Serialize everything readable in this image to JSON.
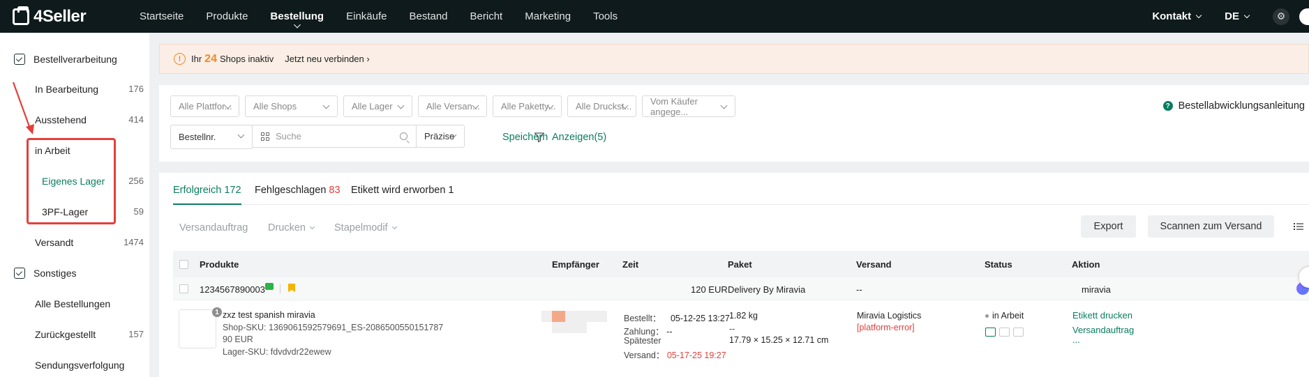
{
  "topbar": {
    "logo": "4Seller",
    "nav": [
      "Startseite",
      "Produkte",
      "Bestellung",
      "Einkäufe",
      "Bestand",
      "Bericht",
      "Marketing",
      "Tools"
    ],
    "active_nav": "Bestellung",
    "contact": "Kontakt",
    "language": "DE"
  },
  "sidebar": {
    "section1": "Bestellverarbeitung",
    "in_progress": {
      "label": "In Bearbeitung",
      "count": "176"
    },
    "pending": {
      "label": "Ausstehend",
      "count": "414"
    },
    "at_work": {
      "label": "in Arbeit"
    },
    "own_warehouse": {
      "label": "Eigenes Lager",
      "count": "256"
    },
    "tpf_warehouse": {
      "label": "3PF-Lager",
      "count": "59"
    },
    "shipped": {
      "label": "Versandt",
      "count": "1474"
    },
    "section2": "Sonstiges",
    "all_orders": {
      "label": "Alle Bestellungen"
    },
    "deferred": {
      "label": "Zurückgestellt",
      "count": "157"
    },
    "tracking": {
      "label": "Sendungsverfolgung"
    }
  },
  "notice": {
    "prefix": "Ihr",
    "count": "24",
    "suffix": "Shops inaktiv",
    "link": "Jetzt neu verbinden"
  },
  "filters": {
    "platform": "Alle Plattfor...",
    "shops": "Alle Shops",
    "warehouse": "Alle Lager",
    "shipping": "Alle Versan...",
    "package": "Alle Paketty...",
    "print": "Alle Druckst...",
    "buyer": "Vom Käufer angege...",
    "field": "Bestellnr.",
    "search_placeholder": "Suche",
    "precision": "Präzise",
    "save": "Speichern",
    "show": "Anzeigen(5)",
    "help": "Bestellabwicklungsanleitung"
  },
  "tabs": {
    "success_label": "Erfolgreich",
    "success_count": "172",
    "failed_label": "Fehlgeschlagen",
    "failed_count": "83",
    "label_label": "Etikett wird erworben",
    "label_count": "1"
  },
  "toolbar": {
    "shipping_order": "Versandauftrag",
    "print": "Drucken",
    "batch": "Stapelmodif",
    "export": "Export",
    "scan": "Scannen zum Versand"
  },
  "table": {
    "headers": {
      "products": "Produkte",
      "recipient": "Empfänger",
      "time": "Zeit",
      "package": "Paket",
      "shipping": "Versand",
      "status": "Status",
      "action": "Aktion"
    },
    "group": {
      "order_no": "1234567890003",
      "amount": "120 EUR",
      "delivery": "Delivery By Miravia",
      "shipping": "--",
      "shop": "miravia"
    },
    "order": {
      "qty": "1",
      "title": "zxz test spanish miravia",
      "shop_sku": "Shop-SKU: 1369061592579691_ES-2086500550151787",
      "price": "90 EUR",
      "warehouse_sku": "Lager-SKU: fdvdvdr22ewew",
      "ordered_label": "Bestellt：",
      "ordered_value": "05-12-25 13:27",
      "payment_label": "Zahlung：",
      "payment_value": "--",
      "latest_label": "Spätester",
      "ship_label": "Versand：",
      "ship_value": "05-17-25 19:27",
      "weight": "1.82 kg",
      "pkg_dash": "--",
      "dimensions": "17.79 × 15.25 × 12.71 cm",
      "carrier": "Miravia Logistics",
      "error": "[platform-error]",
      "status": "in Arbeit",
      "action_print": "Etikett drucken",
      "action_order": "Versandauftrag",
      "action_more": "..."
    }
  },
  "colors": {
    "accent": "#0a7d5e",
    "warning": "#f08a24",
    "error": "#e2403b",
    "topbar": "#0f1a1c"
  }
}
